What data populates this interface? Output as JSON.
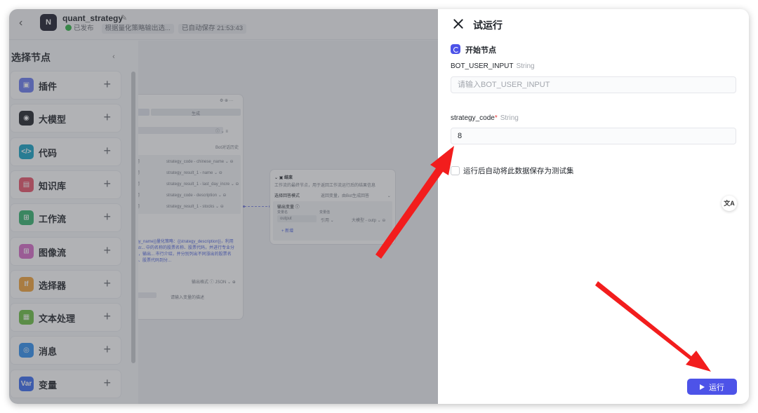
{
  "app": {
    "title": "quant_strategy",
    "status_published": "已发布",
    "description": "根据量化策略输出选...",
    "autosave": "已自动保存 21:53:43",
    "logo": "N"
  },
  "picker": {
    "title": "选择节点",
    "items": [
      {
        "label": "插件",
        "icon": "plugin-icon",
        "color": "#6a7bf0",
        "glyph": "▣"
      },
      {
        "label": "大模型",
        "icon": "llm-icon",
        "color": "#1f2329",
        "glyph": "◉"
      },
      {
        "label": "代码",
        "icon": "code-icon",
        "color": "#15a3c4",
        "glyph": "</>"
      },
      {
        "label": "知识库",
        "icon": "knowledge-icon",
        "color": "#e9536a",
        "glyph": "▤"
      },
      {
        "label": "工作流",
        "icon": "workflow-icon",
        "color": "#35b46f",
        "glyph": "⊞"
      },
      {
        "label": "图像流",
        "icon": "imageflow-icon",
        "color": "#d76bc9",
        "glyph": "⊞"
      },
      {
        "label": "选择器",
        "icon": "selector-icon",
        "color": "#f2a33a",
        "glyph": "If"
      },
      {
        "label": "文本处理",
        "icon": "text-icon",
        "color": "#6cbf43",
        "glyph": "▦"
      },
      {
        "label": "消息",
        "icon": "message-icon",
        "color": "#2f8ff0",
        "glyph": "◎"
      },
      {
        "label": "变量",
        "icon": "variable-icon",
        "color": "#3a6cf0",
        "glyph": "Var"
      }
    ],
    "add_symbol": "+"
  },
  "nodes": {
    "left_node_tab": "生成",
    "left_node_checkbox": "Bot对话历史",
    "left_node_rows": [
      {
        "op": "用",
        "value": "strategy_code - chinese_name"
      },
      {
        "op": "用",
        "value": "strategy_result_1 - name"
      },
      {
        "op": "用",
        "value": "strategy_result_1 - last_day_incre"
      },
      {
        "op": "用",
        "value": "strategy_code - description"
      },
      {
        "op": "用",
        "value": "strategy_result_1 - stocks"
      }
    ],
    "left_node_prompt": "egy_name}}量化策略：{{strategy_description}}，利用{{str... 中的名称的股票名称、股票代码，并进行专业分析，输出... 市行介绍，并分别列出不同涨出的股票名称、股票代码到分...",
    "left_node_output_format": "输出格式 ⓘ",
    "left_node_format_value": "JSON",
    "left_node_param_placeholder": "请输入变量的描述",
    "right_node_title": "结束",
    "right_node_desc": "工作流的最终节点，用于返回工作流运行后的结果信息",
    "right_node_mode_label": "选择回答模式",
    "right_node_mode_value": "返回变量，由Bot生成回答",
    "right_node_output_label": "输出变量 ⓘ",
    "right_node_var_name_label": "变量名",
    "right_node_var_value_label": "变量值",
    "right_node_var_name": "output",
    "right_node_var_op": "引用",
    "right_node_var_value": "大模型 - outp",
    "right_node_add": "+ 新增"
  },
  "panel": {
    "title": "试运行",
    "section_title": "开始节点",
    "fields": [
      {
        "name": "BOT_USER_INPUT",
        "type": "String",
        "required": false,
        "value": "",
        "placeholder": "请输入BOT_USER_INPUT"
      },
      {
        "name": "strategy_code",
        "type": "String",
        "required": true,
        "value": "8",
        "placeholder": ""
      }
    ],
    "required_mark": "*",
    "save_option": "运行后自动将此数据保存为测试集",
    "run_label": "运行",
    "translate_glyph": "文A"
  },
  "colors": {
    "accent": "#4d53e8",
    "arrow": "#f21d1d"
  }
}
